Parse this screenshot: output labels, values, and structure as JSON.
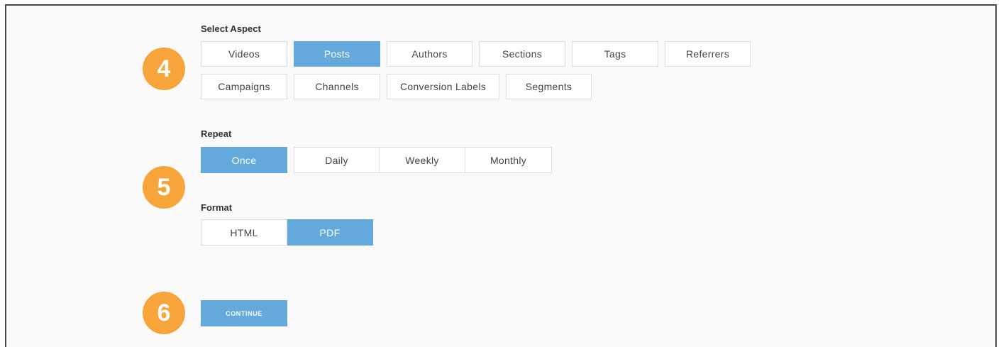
{
  "aspect": {
    "label": "Select Aspect",
    "step": "4",
    "row1": [
      "Videos",
      "Posts",
      "Authors",
      "Sections",
      "Tags",
      "Referrers"
    ],
    "row2": [
      "Campaigns",
      "Channels",
      "Conversion Labels",
      "Segments"
    ],
    "selected": "Posts"
  },
  "repeat": {
    "label": "Repeat",
    "step": "5",
    "options": [
      "Once",
      "Daily",
      "Weekly",
      "Monthly"
    ],
    "selected": "Once"
  },
  "format": {
    "label": "Format",
    "options": [
      "HTML",
      "PDF"
    ],
    "selected": "PDF"
  },
  "continue": {
    "step": "6",
    "label": "CONTINUE"
  },
  "colors": {
    "accent": "#63a9dc",
    "badge": "#f7a43a",
    "frame_border": "#4a4a4a"
  }
}
